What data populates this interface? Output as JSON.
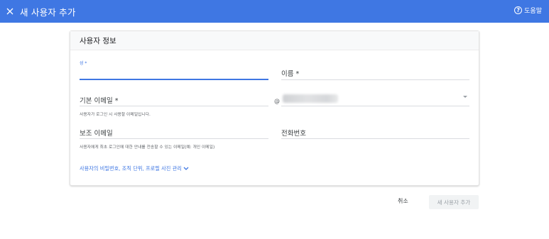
{
  "header": {
    "title": "새 사용자 추가",
    "help_label": "도움말",
    "help_symbol": "?",
    "accent_color": "#3f77e3"
  },
  "card": {
    "title": "사용자 정보",
    "fields": {
      "last_name": {
        "label": "성 *",
        "value": ""
      },
      "first_name": {
        "label": "이름 *"
      },
      "primary_email": {
        "label": "기본 이메일 *",
        "at": "@",
        "hint": "사용자가 로그인 시 사용할 이메일입니다."
      },
      "secondary_email": {
        "label": "보조 이메일",
        "hint": "사용자에게 최초 로그인에 대한 안내를 전송할 수 있는 이메일(예: 개인 이메일)"
      },
      "phone": {
        "label": "전화번호"
      }
    },
    "more_link": "사용자의 비밀번호, 조직 단위, 프로필 사진 관리"
  },
  "footer": {
    "cancel_label": "취소",
    "add_label": "새 사용자 추가"
  }
}
